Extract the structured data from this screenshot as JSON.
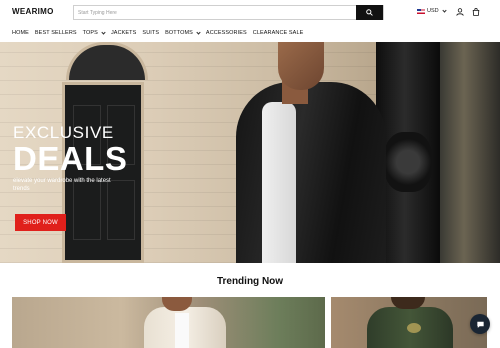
{
  "header": {
    "logo": "WEARIMO",
    "search_placeholder": "Start Typing Here",
    "currency": "USD",
    "icons": [
      "search-icon",
      "us-flag-icon",
      "chevron-down-icon",
      "user-icon",
      "cart-icon"
    ]
  },
  "nav": {
    "items": [
      {
        "label": "HOME",
        "dropdown": false
      },
      {
        "label": "BEST SELLERS",
        "dropdown": false
      },
      {
        "label": "TOPS",
        "dropdown": true
      },
      {
        "label": "JACKETS",
        "dropdown": false
      },
      {
        "label": "SUITS",
        "dropdown": false
      },
      {
        "label": "BOTTOMS",
        "dropdown": true
      },
      {
        "label": "ACCESSORIES",
        "dropdown": false
      },
      {
        "label": "CLEARANCE SALE",
        "dropdown": false
      }
    ]
  },
  "hero": {
    "title_line1": "EXCLUSIVE",
    "title_line2": "DEALS",
    "subtitle": "elevate your wardrobe with the latest trends",
    "cta": "SHOP NOW",
    "cta_color": "#e0201b"
  },
  "trending": {
    "heading": "Trending Now"
  },
  "chat": {
    "icon": "chat-icon",
    "color": "#1a2533"
  }
}
